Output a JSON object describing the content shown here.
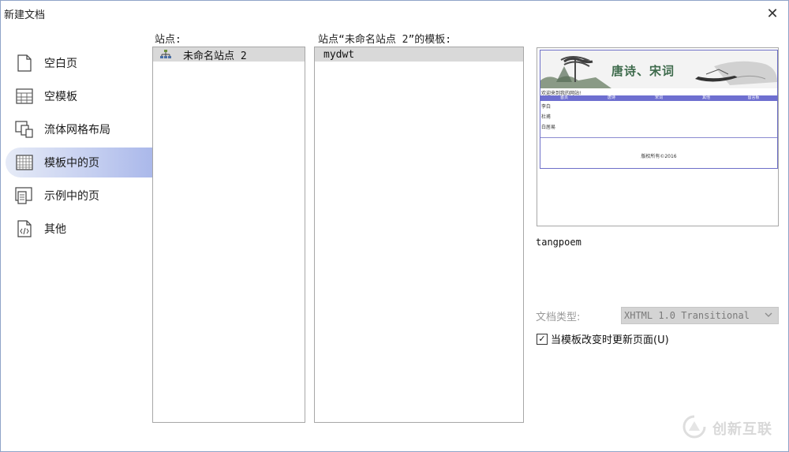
{
  "window": {
    "title": "新建文档",
    "close_glyph": "✕"
  },
  "categories": [
    {
      "label": "空白页",
      "icon": "blank-page-icon",
      "selected": false
    },
    {
      "label": "空模板",
      "icon": "blank-template-icon",
      "selected": false
    },
    {
      "label": "流体网格布局",
      "icon": "fluid-grid-icon",
      "selected": false
    },
    {
      "label": "模板中的页",
      "icon": "template-page-icon",
      "selected": true
    },
    {
      "label": "示例中的页",
      "icon": "sample-page-icon",
      "selected": false
    },
    {
      "label": "其他",
      "icon": "code-file-icon",
      "selected": false
    }
  ],
  "sites": {
    "label": "站点:",
    "items": [
      {
        "label": "未命名站点 2",
        "icon": "site-icon"
      }
    ]
  },
  "templates": {
    "label": "站点“未命名站点 2”的模板:",
    "items": [
      {
        "label": "mydwt"
      }
    ]
  },
  "preview": {
    "title": "唐诗、宋词",
    "welcome": "欢迎来到我的网站!",
    "nav": [
      "首页",
      "唐诗",
      "宋词",
      "其他",
      "留言板"
    ],
    "side": [
      "李白",
      "杜甫",
      "白居易"
    ],
    "copyright": "版权所有©2016",
    "template_name": "tangpoem"
  },
  "doctype": {
    "label": "文档类型:",
    "value": "XHTML 1.0 Transitional"
  },
  "update_checkbox": {
    "label": "当模板改变时更新页面(U)",
    "checked": true,
    "check_glyph": "✓"
  },
  "watermark": {
    "text": "创新互联"
  },
  "colors": {
    "selection_gradient_end": "#aab8ea",
    "row_highlight": "#d9d9d9",
    "preview_nav": "#6e6fd0"
  }
}
